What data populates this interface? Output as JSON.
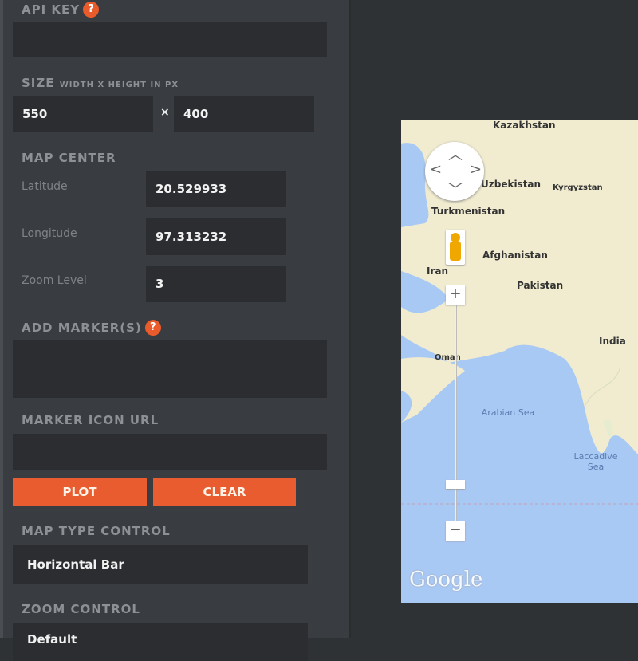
{
  "form": {
    "api_key": {
      "label": "API KEY",
      "help": "?",
      "value": ""
    },
    "size": {
      "label": "SIZE",
      "hint": "WIDTH X HEIGHT IN PX",
      "width": "550",
      "separator": "×",
      "height": "400"
    },
    "map_center": {
      "label": "MAP CENTER",
      "latitude_label": "Latitude",
      "latitude": "20.529933",
      "longitude_label": "Longitude",
      "longitude": "97.313232",
      "zoom_label": "Zoom Level",
      "zoom": "3"
    },
    "markers": {
      "label": "ADD MARKER(S)",
      "help": "?",
      "value": ""
    },
    "marker_icon": {
      "label": "MARKER ICON URL",
      "value": ""
    },
    "plot_label": "PLOT",
    "clear_label": "CLEAR",
    "map_type_control": {
      "label": "MAP TYPE CONTROL",
      "value": "Horizontal Bar"
    },
    "zoom_control": {
      "label": "ZOOM CONTROL",
      "value": "Default"
    }
  },
  "map": {
    "labels": [
      "Kazakhstan",
      "Uzbekistan",
      "Kyrgyzstan",
      "Turkmenistan",
      "Afghanistan",
      "Iran",
      "Pakistan",
      "India",
      "Oman"
    ],
    "seas": [
      "Arabian Sea",
      "Laccadive Sea"
    ],
    "logo": "Google",
    "colors": {
      "land": "#f1eccf",
      "water": "#a9c9f5",
      "accent": "#e85c30"
    }
  }
}
